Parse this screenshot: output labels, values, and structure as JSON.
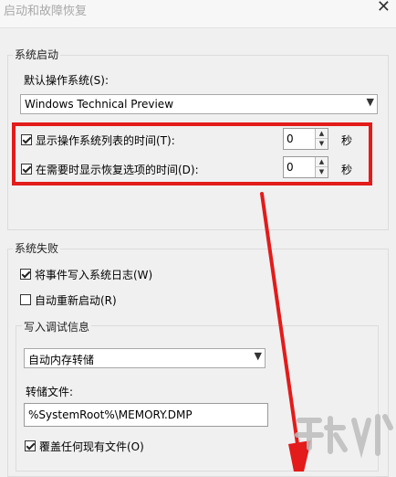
{
  "window": {
    "title": "启动和故障恢复",
    "close_glyph": "✕"
  },
  "system_startup": {
    "group_label": "系统启动",
    "default_os_label": "默认操作系统(S):",
    "default_os_value": "Windows Technical Preview",
    "show_os_list": {
      "label": "显示操作系统列表的时间(T):",
      "checked": true,
      "value": "0",
      "unit": "秒"
    },
    "show_recovery": {
      "label": "在需要时显示恢复选项的时间(D):",
      "checked": true,
      "value": "0",
      "unit": "秒"
    }
  },
  "system_failure": {
    "group_label": "系统失败",
    "write_event": {
      "label": "将事件写入系统日志(W)",
      "checked": true
    },
    "auto_restart": {
      "label": "自动重新启动(R)",
      "checked": false
    },
    "debug_info": {
      "group_label": "写入调试信息",
      "dump_type_value": "自动内存转储",
      "dump_file_label": "转储文件:",
      "dump_file_value": "%SystemRoot%\\MEMORY.DMP",
      "overwrite": {
        "label": "覆盖任何现有文件(O)",
        "checked": true
      }
    }
  },
  "colors": {
    "highlight": "#e31b1b",
    "annotation_arrow": "#e31b1b"
  },
  "watermark": {
    "icon": "download-site-logo"
  }
}
